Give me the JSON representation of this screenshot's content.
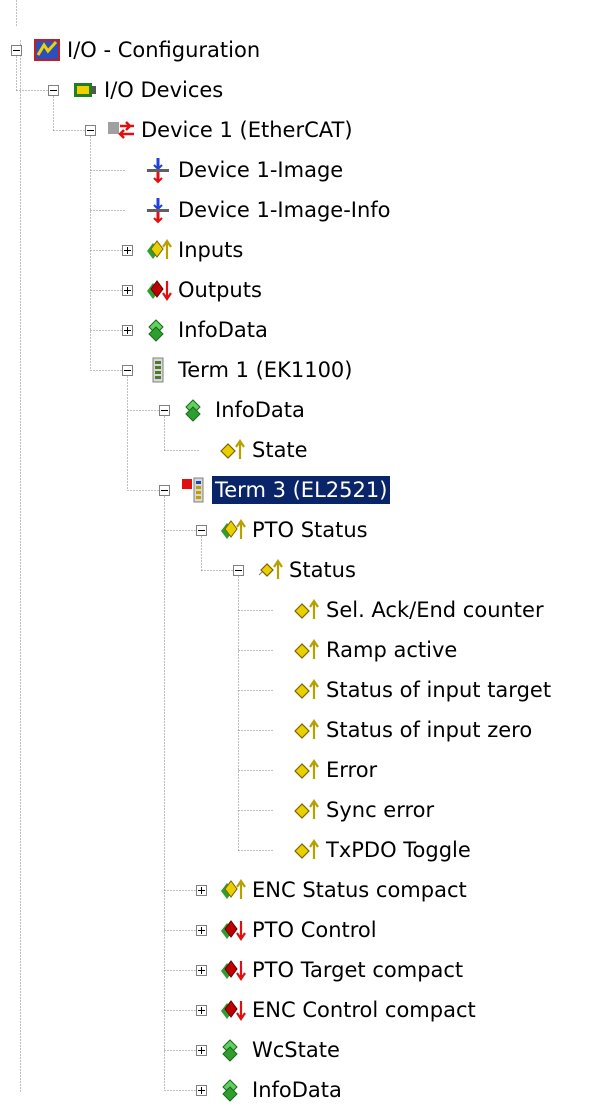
{
  "tree": {
    "nodes": [
      {
        "id": "io-configuration",
        "label": "I/O - Configuration",
        "icon": "io-config-icon",
        "level": 0,
        "state": "expanded"
      },
      {
        "id": "io-devices",
        "label": "I/O Devices",
        "icon": "io-devices-icon",
        "level": 1,
        "state": "expanded"
      },
      {
        "id": "device-1",
        "label": "Device 1 (EtherCAT)",
        "icon": "ethercat-device-icon",
        "level": 2,
        "state": "expanded"
      },
      {
        "id": "device-1-image",
        "label": "Device 1-Image",
        "icon": "process-image-icon",
        "level": 3,
        "state": "leaf"
      },
      {
        "id": "device-1-image-info",
        "label": "Device 1-Image-Info",
        "icon": "process-image-icon",
        "level": 3,
        "state": "leaf"
      },
      {
        "id": "inputs",
        "label": "Inputs",
        "icon": "input-group-icon",
        "level": 3,
        "state": "collapsed"
      },
      {
        "id": "outputs",
        "label": "Outputs",
        "icon": "output-group-icon",
        "level": 3,
        "state": "collapsed"
      },
      {
        "id": "infodata-device",
        "label": "InfoData",
        "icon": "infodata-group-icon",
        "level": 3,
        "state": "collapsed"
      },
      {
        "id": "term-1",
        "label": "Term 1 (EK1100)",
        "icon": "ek1100-terminal-icon",
        "level": 3,
        "state": "expanded"
      },
      {
        "id": "term-1-infodata",
        "label": "InfoData",
        "icon": "infodata-group-icon",
        "level": 4,
        "state": "expanded"
      },
      {
        "id": "term-1-state",
        "label": "State",
        "icon": "input-variable-icon",
        "level": 5,
        "state": "leaf"
      },
      {
        "id": "term-3",
        "label": "Term 3 (EL2521)",
        "icon": "el2521-terminal-icon",
        "level": 4,
        "state": "expanded",
        "selected": true
      },
      {
        "id": "pto-status",
        "label": "PTO Status",
        "icon": "input-group-icon",
        "level": 5,
        "state": "expanded"
      },
      {
        "id": "status",
        "label": "Status",
        "icon": "input-variable-group-icon",
        "level": 6,
        "state": "expanded"
      },
      {
        "id": "sel-ack-end-counter",
        "label": "Sel. Ack/End counter",
        "icon": "input-variable-icon",
        "level": 7,
        "state": "leaf"
      },
      {
        "id": "ramp-active",
        "label": "Ramp active",
        "icon": "input-variable-icon",
        "level": 7,
        "state": "leaf"
      },
      {
        "id": "status-input-target",
        "label": "Status of input target",
        "icon": "input-variable-icon",
        "level": 7,
        "state": "leaf"
      },
      {
        "id": "status-input-zero",
        "label": "Status of input zero",
        "icon": "input-variable-icon",
        "level": 7,
        "state": "leaf"
      },
      {
        "id": "error",
        "label": "Error",
        "icon": "input-variable-icon",
        "level": 7,
        "state": "leaf"
      },
      {
        "id": "sync-error",
        "label": "Sync error",
        "icon": "input-variable-icon",
        "level": 7,
        "state": "leaf"
      },
      {
        "id": "txpdo-toggle",
        "label": "TxPDO Toggle",
        "icon": "input-variable-icon",
        "level": 7,
        "state": "leaf"
      },
      {
        "id": "enc-status-compact",
        "label": "ENC Status compact",
        "icon": "input-group-icon",
        "level": 5,
        "state": "collapsed"
      },
      {
        "id": "pto-control",
        "label": "PTO Control",
        "icon": "output-group-icon",
        "level": 5,
        "state": "collapsed"
      },
      {
        "id": "pto-target-compact",
        "label": "PTO Target compact",
        "icon": "output-group-icon",
        "level": 5,
        "state": "collapsed"
      },
      {
        "id": "enc-control-compact",
        "label": "ENC Control compact",
        "icon": "output-group-icon",
        "level": 5,
        "state": "collapsed"
      },
      {
        "id": "wcstate",
        "label": "WcState",
        "icon": "infodata-group-icon",
        "level": 5,
        "state": "collapsed"
      },
      {
        "id": "infodata-term3",
        "label": "InfoData",
        "icon": "infodata-group-icon",
        "level": 5,
        "state": "collapsed"
      }
    ]
  },
  "colors": {
    "selection_bg": "#0a246a",
    "selection_text": "#ffffff",
    "tree_lines": "#808080",
    "input_arrow": "#b8a000",
    "output_arrow": "#e01010",
    "group_green": "#2e9e2e",
    "group_yellow": "#e8d000",
    "group_red": "#c00000"
  }
}
